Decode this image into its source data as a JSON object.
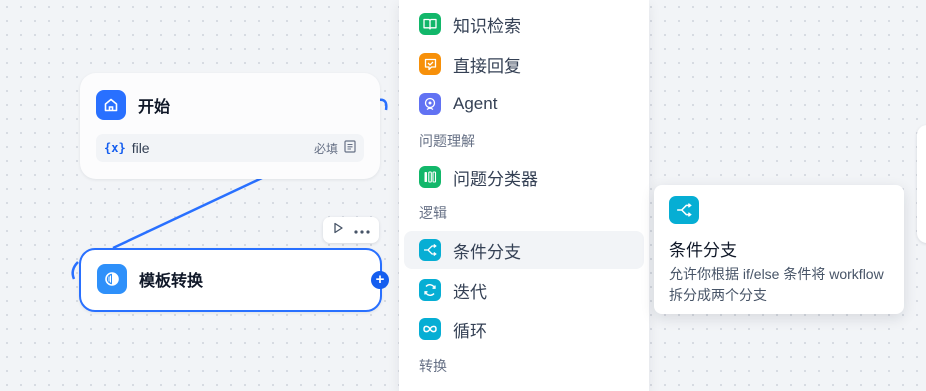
{
  "colors": {
    "accent": "#155eef",
    "edge": "#2970ff",
    "start_icon": "#2970ff",
    "template_icon": "#2e90fa",
    "knowledge_icon": "#12b76a",
    "answer_icon": "#f79009",
    "agent_icon": "#6172f3",
    "classifier_icon": "#12b76a",
    "logic_icon": "#06aed4"
  },
  "start_node": {
    "title": "开始",
    "icon": "home-icon",
    "variable": {
      "icon_text": "{x}",
      "name": "file",
      "required": "必填"
    }
  },
  "template_node": {
    "title": "模板转换",
    "icon": "template-transform-icon"
  },
  "block_menu": {
    "items": [
      {
        "label": "知识检索",
        "icon": "book-icon"
      },
      {
        "label": "直接回复",
        "icon": "reply-icon"
      },
      {
        "label": "Agent",
        "icon": "agent-icon"
      }
    ],
    "groups": {
      "question": "问题理解",
      "logic": "逻辑",
      "transform": "转换"
    },
    "question_items": [
      {
        "label": "问题分类器",
        "icon": "classifier-icon"
      }
    ],
    "logic_items": [
      {
        "label": "条件分支",
        "icon": "branch-icon"
      },
      {
        "label": "迭代",
        "icon": "iteration-icon"
      },
      {
        "label": "循环",
        "icon": "loop-icon"
      }
    ]
  },
  "tooltip": {
    "title": "条件分支",
    "description": "允许你根据 if/else 条件将 workflow 拆分成两个分支"
  }
}
